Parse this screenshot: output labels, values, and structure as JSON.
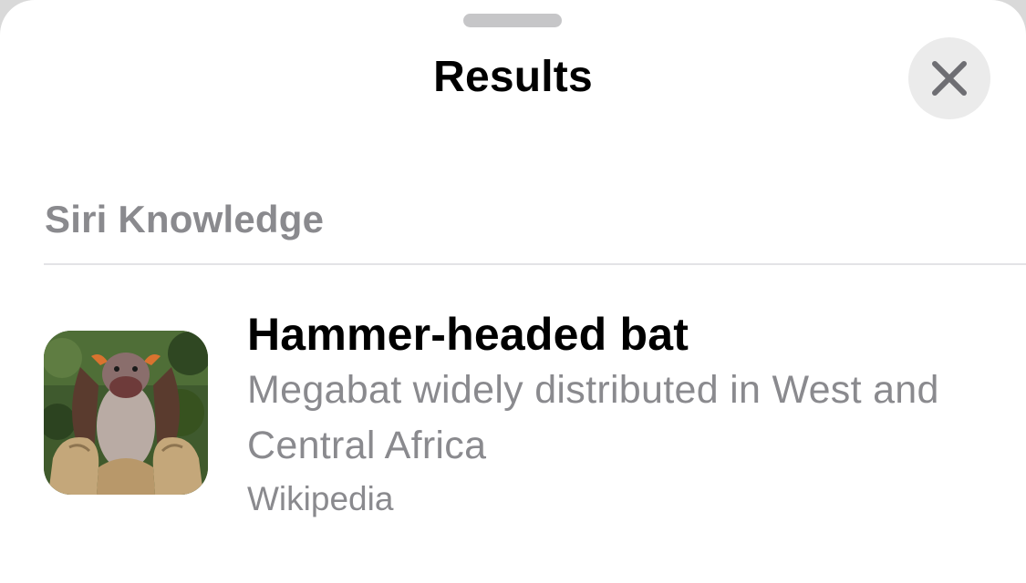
{
  "sheet": {
    "title": "Results"
  },
  "section": {
    "title": "Siri Knowledge"
  },
  "result": {
    "title": "Hammer-headed bat",
    "description": "Megabat widely distributed in West and Central Africa",
    "source": "Wikipedia",
    "thumbnail_icon": "bat-photo"
  },
  "colors": {
    "background": "#ffffff",
    "secondary_text": "#8a8a8e",
    "grabber": "#c6c6c8",
    "close_button_bg": "#ebebeb",
    "close_icon": "#6e6e73"
  }
}
